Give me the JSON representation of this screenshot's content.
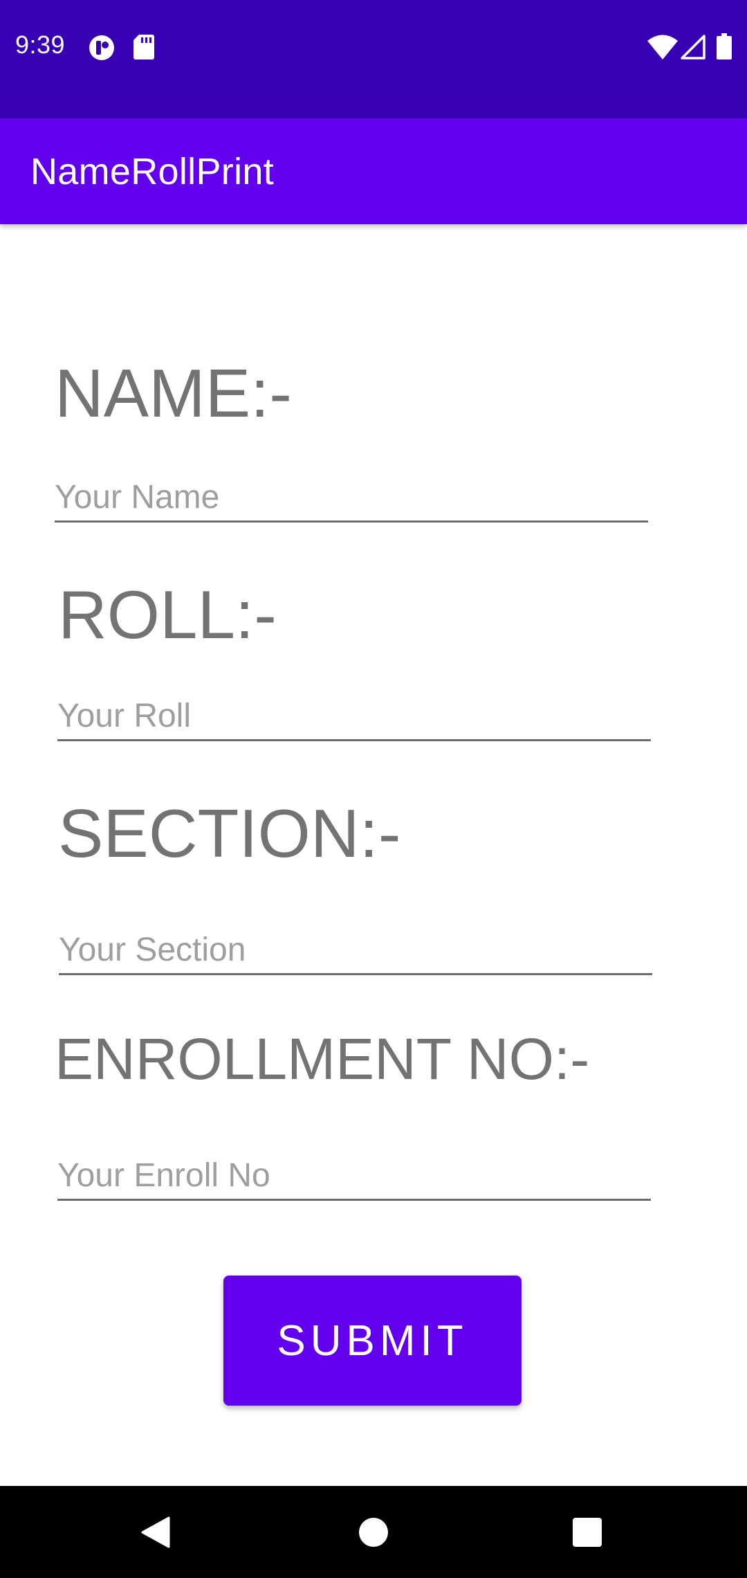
{
  "status_bar": {
    "time": "9:39",
    "icons": [
      "notification-icon",
      "sd-card-icon",
      "wifi-icon",
      "cell-signal-icon",
      "battery-icon"
    ]
  },
  "app_bar": {
    "title": "NameRollPrint"
  },
  "form": {
    "name_label": "NAME:-",
    "name_placeholder": "Your Name",
    "roll_label": "ROLL:-",
    "roll_placeholder": "Your Roll",
    "section_label": "SECTION:-",
    "section_placeholder": "Your Section",
    "enroll_label": "ENROLLMENT NO:-",
    "enroll_placeholder": "Your Enroll No",
    "submit_label": "SUBMIT"
  },
  "nav_bar": {
    "icons": [
      "back-icon",
      "home-icon",
      "recents-icon"
    ]
  },
  "colors": {
    "status_bar": "#3700B3",
    "primary": "#6200EE",
    "label_text": "#737373",
    "hint_text": "#9E9E9E"
  }
}
